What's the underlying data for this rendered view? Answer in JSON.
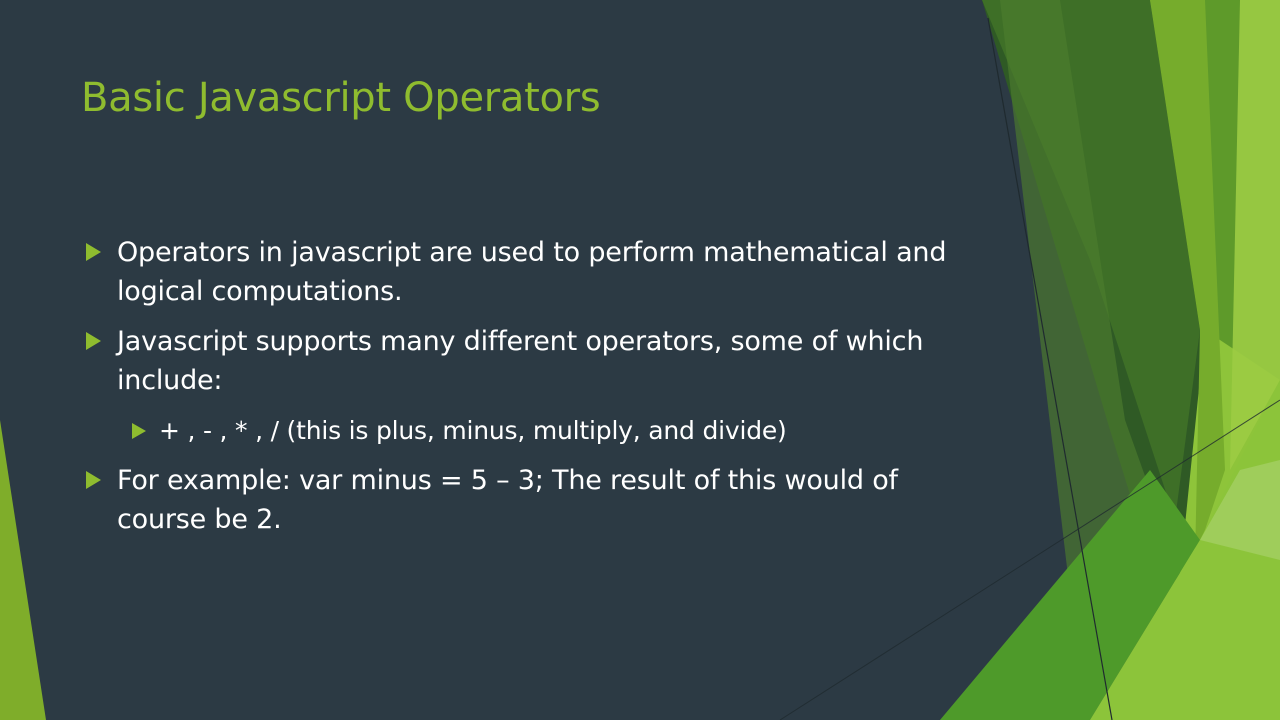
{
  "slide": {
    "title": "Basic Javascript Operators",
    "bullets": [
      {
        "text": "Operators in javascript are used to perform mathematical and logical computations."
      },
      {
        "text": "Javascript supports many different operators, some of which include:"
      },
      {
        "text": "+ , - , * , / (this is plus, minus, multiply, and divide)"
      },
      {
        "text": "For example: var minus = 5 – 3; The result of this would of course be 2."
      }
    ]
  },
  "colors": {
    "background": "#2c3a44",
    "accent": "#8fbc2f",
    "text": "#ffffff"
  }
}
